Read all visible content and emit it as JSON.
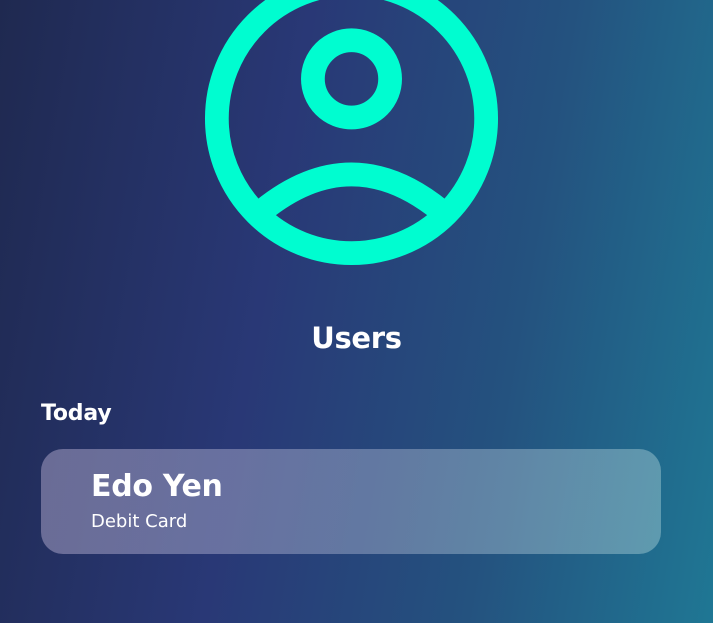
{
  "header": {
    "icon": "user-circle-icon",
    "icon_color": "#00fdd0",
    "title": "Users"
  },
  "sections": [
    {
      "label": "Today",
      "items": [
        {
          "name": "Edo Yen",
          "subtitle": "Debit Card"
        }
      ]
    }
  ],
  "colors": {
    "background_start": "#1f2950",
    "background_mid": "#293876",
    "background_end": "#1f7794",
    "text": "#ffffff",
    "accent": "#00fdd0"
  }
}
